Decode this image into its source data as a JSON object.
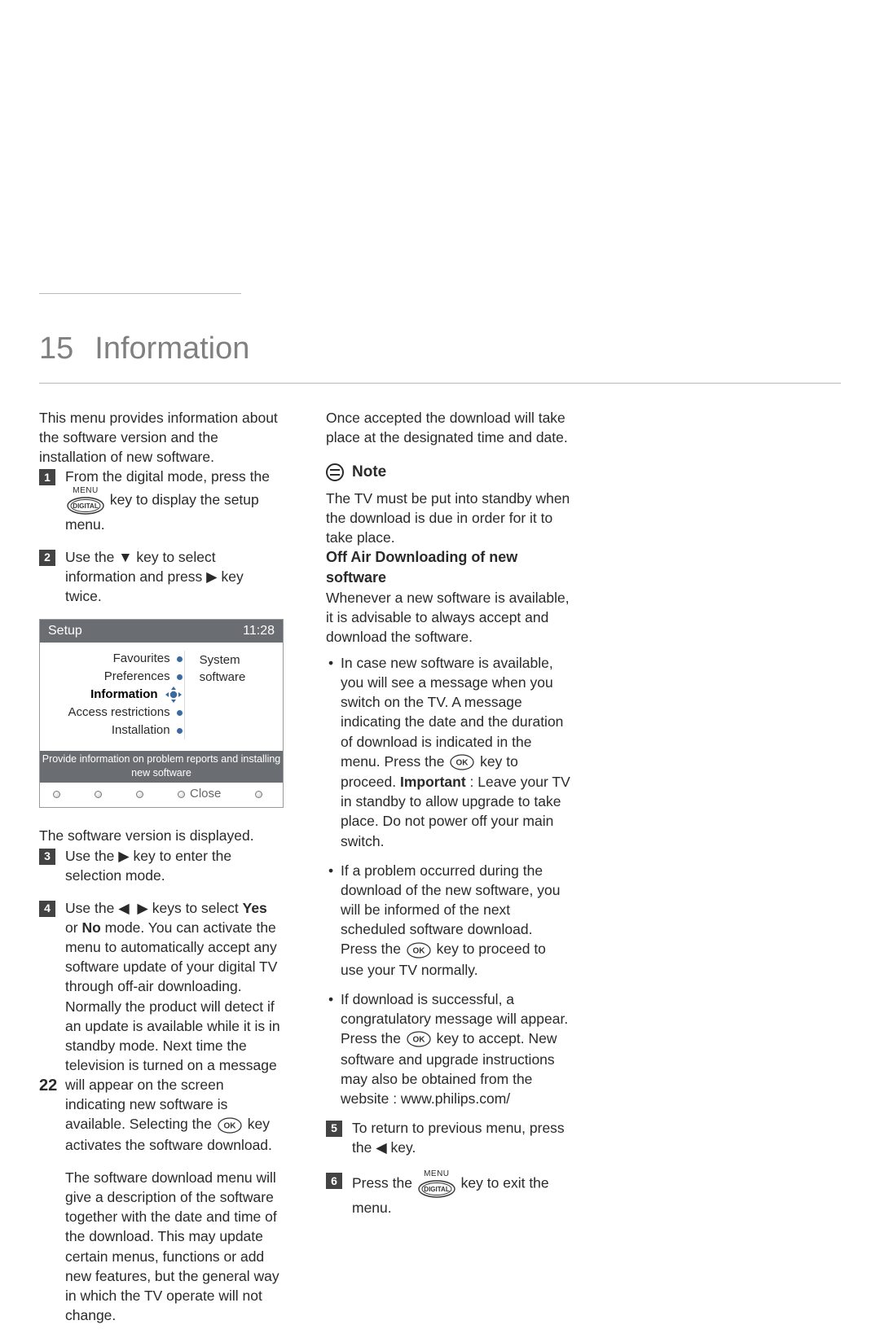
{
  "chapter": {
    "number": "15",
    "title": "Information"
  },
  "intro": "This menu provides information about the software version and the installation of new software.",
  "steps": {
    "s1a": "From the digital mode, press the ",
    "s1b": " key to display the setup menu.",
    "s2a": "Use the ",
    "s2b": " key to select information and press ",
    "s2c": " key twice.",
    "s3a": "Use the ",
    "s3b": " key to enter the selection mode.",
    "s4a": "Use the ",
    "s4b": " keys to select ",
    "s4yes": "Yes",
    "s4c": " or ",
    "s4no": "No",
    "s4d": " mode. You can activate the menu to automatically accept any software update of your digital TV through off-air downloading. Normally the product will detect if an update is available while it is in standby mode. Next time the television is turned on a message will appear on the screen indicating new software is available. Selecting the ",
    "s4e": " key activates the software download.",
    "s4f": "The software download menu will give a description of the software together with the date and time of the download. This may update certain menus, functions or add new features, but the general way in which the TV operate will not change.",
    "s5a": "To return to previous menu, press the ",
    "s5b": " key.",
    "s6a": "Press the ",
    "s6b": " key to exit the menu."
  },
  "afterOsd": "The software version is displayed.",
  "right": {
    "p1": "Once accepted the download will take place at the designated time and date.",
    "noteHead": "Note",
    "note": "The TV must be put into standby when the download is due in order for it to take place.",
    "offAirHead": "Off Air Downloading of new software",
    "offAirP": "Whenever a new software is available, it is advisable to always accept and download the software.",
    "b1a": "In case new software is available, you will see a message when you switch on the TV. A message indicating the date and the duration of download is indicated in the menu. Press the ",
    "b1b": " key to proceed. ",
    "b1imp": "Important",
    "b1c": " : Leave your TV in standby to allow upgrade to take place. Do not power off your main switch.",
    "b2a": "If a problem occurred during the download of the new software, you will be informed of the next scheduled software download. Press the ",
    "b2b": " key to proceed to use your TV normally.",
    "b3a": "If download is successful, a congratulatory message will appear. Press the ",
    "b3b": " key to accept. New software and upgrade instructions may also be obtained from the website : www.philips.com/"
  },
  "osd": {
    "title": "Setup",
    "time": "11:28",
    "items": [
      "Favourites",
      "Preferences",
      "Information",
      "Access restrictions",
      "Installation"
    ],
    "right": "System software",
    "hint": "Provide information on problem reports and installing new software",
    "close": "Close"
  },
  "glyphs": {
    "down": "▼",
    "right": "▶",
    "left": "◀",
    "menu": "MENU",
    "digital": "DIGITAL",
    "ok": "OK"
  },
  "pageNumber": "22"
}
